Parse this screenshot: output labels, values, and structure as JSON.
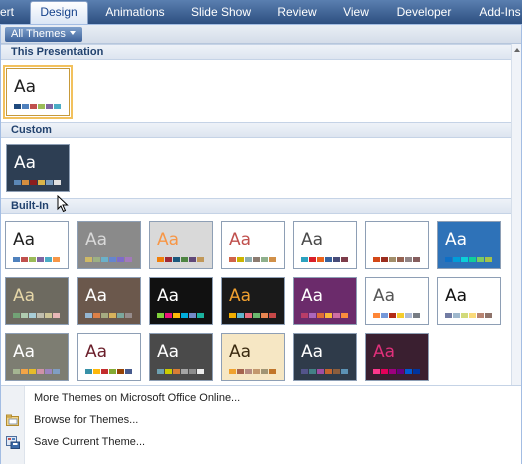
{
  "ribbon": {
    "tabs": [
      {
        "label": "ert",
        "name": "tab-insert",
        "active": false
      },
      {
        "label": "Design",
        "name": "tab-design",
        "active": true
      },
      {
        "label": "Animations",
        "name": "tab-animations",
        "active": false
      },
      {
        "label": "Slide Show",
        "name": "tab-slide-show",
        "active": false
      },
      {
        "label": "Review",
        "name": "tab-review",
        "active": false
      },
      {
        "label": "View",
        "name": "tab-view",
        "active": false
      },
      {
        "label": "Developer",
        "name": "tab-developer",
        "active": false
      },
      {
        "label": "Add-Ins",
        "name": "tab-add-ins",
        "active": false
      }
    ]
  },
  "gallery": {
    "filter_label": "All Themes",
    "sections": {
      "this_presentation": "This Presentation",
      "custom": "Custom",
      "built_in": "Built-In"
    },
    "theme_sample_text": "Aa",
    "selected_theme": "this-presentation-office",
    "themes": {
      "this_presentation": [
        {
          "id": "this-presentation-office",
          "bg": "#ffffff",
          "fg": "#1f1f1f",
          "swatches": [
            "#1f497d",
            "#4f81bd",
            "#c0504d",
            "#9bbb59",
            "#8064a2",
            "#4bacc6"
          ]
        }
      ],
      "custom": [
        {
          "id": "custom-1",
          "bg": "#2d3e53",
          "fg": "#ffffff",
          "swatches": [
            "#5b87b6",
            "#d48e3f",
            "#8b1e1e",
            "#d9b44a",
            "#7a9dc0",
            "#e0e0e0"
          ]
        }
      ],
      "built_in": [
        {
          "id": "office-theme",
          "bg": "#ffffff",
          "fg": "#1f1f1f",
          "swatches": [
            "#4f81bd",
            "#c0504d",
            "#9bbb59",
            "#8064a2",
            "#4bacc6",
            "#f79646"
          ]
        },
        {
          "id": "apex",
          "bg": "#8a8a8a",
          "fg": "#d9d9d9",
          "swatches": [
            "#ceb966",
            "#9cb084",
            "#6bb1c9",
            "#6585cf",
            "#7e6bc9",
            "#a379bb"
          ]
        },
        {
          "id": "aspect",
          "bg": "#d9d9d9",
          "fg": "#f79646",
          "swatches": [
            "#f07f09",
            "#9f2936",
            "#1b587c",
            "#4e8542",
            "#604878",
            "#c19859"
          ]
        },
        {
          "id": "civic",
          "bg": "#ffffff",
          "fg": "#c0504d",
          "swatches": [
            "#d16349",
            "#ccb400",
            "#8cadae",
            "#8c7b70",
            "#8fb08c",
            "#d19049"
          ]
        },
        {
          "id": "concourse",
          "bg": "#ffffff",
          "fg": "#4a4a4a",
          "swatches": [
            "#2da2bf",
            "#da1f28",
            "#eb641b",
            "#39639d",
            "#474b78",
            "#7d3c4a"
          ]
        },
        {
          "id": "equity",
          "bg": "#ffffff",
          "fg": "#ffffff",
          "swatches": [
            "#d34817",
            "#9b2d1f",
            "#a28e6a",
            "#956251",
            "#918485",
            "#855d5d"
          ]
        },
        {
          "id": "flow",
          "bg": "#2e72b8",
          "fg": "#ffffff",
          "swatches": [
            "#0f6fc6",
            "#009dd9",
            "#0bd0d9",
            "#10cf9b",
            "#7cca62",
            "#a5c249"
          ]
        },
        {
          "id": "foundry",
          "bg": "#6d6a60",
          "fg": "#e6d7a8",
          "swatches": [
            "#72a376",
            "#b0ccb0",
            "#a8cdd7",
            "#c0beaf",
            "#cec597",
            "#e8b7b7"
          ]
        },
        {
          "id": "median",
          "bg": "#6b584c",
          "fg": "#ffffff",
          "swatches": [
            "#94b6d2",
            "#dd8047",
            "#a5ab81",
            "#d8b25c",
            "#7ba79d",
            "#968c8c"
          ]
        },
        {
          "id": "metro",
          "bg": "#111111",
          "fg": "#ffffff",
          "swatches": [
            "#7fd13b",
            "#ea157a",
            "#feb80a",
            "#00addc",
            "#738ac8",
            "#1ab39f"
          ]
        },
        {
          "id": "module",
          "bg": "#1a1a1a",
          "fg": "#f0a030",
          "swatches": [
            "#f0ad00",
            "#60b5cc",
            "#e66c7d",
            "#6bb76d",
            "#e88651",
            "#c64847"
          ]
        },
        {
          "id": "opulent",
          "bg": "#6b2b6b",
          "fg": "#ffffff",
          "swatches": [
            "#b83d68",
            "#ac66bb",
            "#de6c36",
            "#f9b639",
            "#cf6da4",
            "#fa8d3d"
          ]
        },
        {
          "id": "oriel",
          "bg": "#ffffff",
          "fg": "#555555",
          "swatches": [
            "#fe8637",
            "#7598d9",
            "#b32c16",
            "#f5cd2d",
            "#aebad5",
            "#777c84"
          ]
        },
        {
          "id": "origin",
          "bg": "#ffffff",
          "fg": "#111111",
          "swatches": [
            "#727ca3",
            "#9fb8cd",
            "#d2da7a",
            "#fada7a",
            "#b88472",
            "#8e736a"
          ]
        },
        {
          "id": "paper",
          "bg": "#7d7d72",
          "fg": "#ffffff",
          "swatches": [
            "#a5b592",
            "#f3a447",
            "#e7bc29",
            "#d092a7",
            "#9c85c0",
            "#809ec2"
          ]
        },
        {
          "id": "solstice",
          "bg": "#ffffff",
          "fg": "#6b1f2b",
          "swatches": [
            "#3891a7",
            "#feb80a",
            "#c32d2e",
            "#84aa33",
            "#964305",
            "#475a8d"
          ]
        },
        {
          "id": "technic",
          "bg": "#4a4a4a",
          "fg": "#ffffff",
          "swatches": [
            "#6ea0b0",
            "#cccc00",
            "#d97d35",
            "#a5a5a5",
            "#8c8c8c",
            "#ebebeb"
          ]
        },
        {
          "id": "trek",
          "bg": "#f6e7c4",
          "fg": "#3a2a10",
          "swatches": [
            "#f0a22e",
            "#a5644e",
            "#b58b80",
            "#c3986d",
            "#a19574",
            "#c17529"
          ]
        },
        {
          "id": "urban",
          "bg": "#2f3b4a",
          "fg": "#ffffff",
          "swatches": [
            "#53548a",
            "#438086",
            "#a04da3",
            "#c4652d",
            "#8b5d3d",
            "#5c92b5"
          ]
        },
        {
          "id": "verve",
          "bg": "#3a1f30",
          "fg": "#e0307a",
          "swatches": [
            "#ff388c",
            "#e40059",
            "#9c007f",
            "#68007f",
            "#005bd3",
            "#00349e"
          ]
        }
      ]
    },
    "colors": {
      "ribbon_top": "#5a7fb0",
      "ribbon_bottom": "#2d4f80",
      "selection_outline": "#f2c15d"
    }
  },
  "menu": {
    "items": [
      {
        "label": "More Themes on Microsoft Office Online...",
        "icon": null
      },
      {
        "label": "Browse for Themes...",
        "icon": "folder-icon"
      },
      {
        "label": "Save Current Theme...",
        "icon": "save-theme-icon"
      }
    ]
  }
}
